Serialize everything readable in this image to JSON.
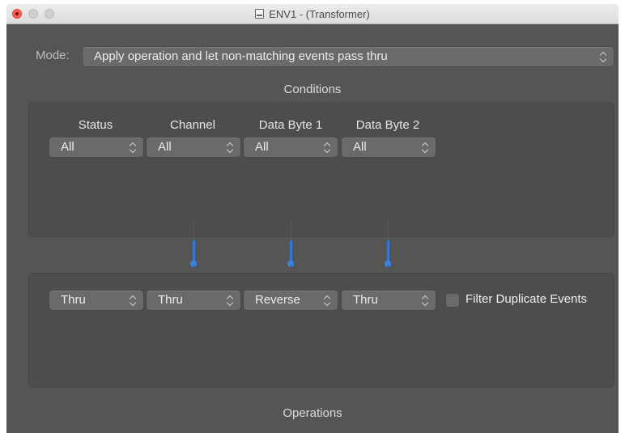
{
  "window": {
    "title": "ENV1 - (Transformer)"
  },
  "mode": {
    "label": "Mode:",
    "value": "Apply operation and let non-matching events pass thru"
  },
  "conditions": {
    "header": "Conditions",
    "columns": [
      {
        "label": "Status",
        "value": "All"
      },
      {
        "label": "Channel",
        "value": "All"
      },
      {
        "label": "Data Byte 1",
        "value": "All"
      },
      {
        "label": "Data Byte 2",
        "value": "All"
      }
    ]
  },
  "operations": {
    "header": "Operations",
    "columns": [
      {
        "value": "Thru"
      },
      {
        "value": "Thru"
      },
      {
        "value": "Reverse"
      },
      {
        "value": "Thru"
      }
    ],
    "filter_duplicates": {
      "label": "Filter Duplicate Events",
      "checked": false
    }
  },
  "colors": {
    "accent": "#3478d4",
    "background": "#555555",
    "panel": "#4d4d4d",
    "close": "#fc5f57"
  }
}
